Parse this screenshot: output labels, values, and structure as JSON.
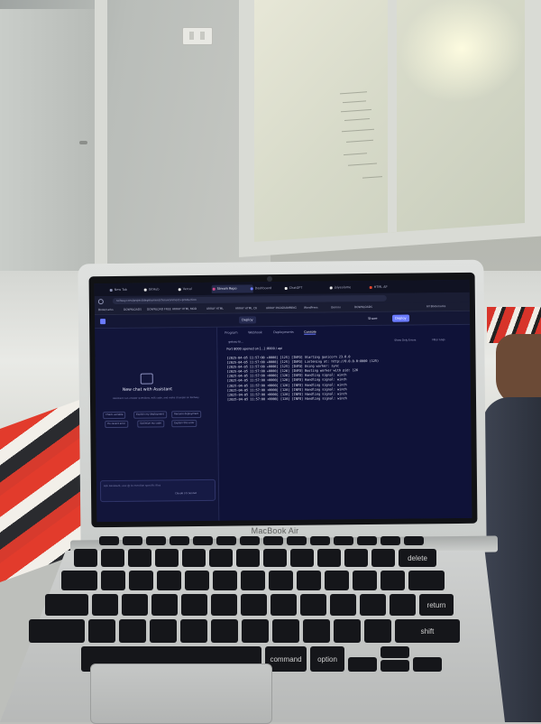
{
  "laptop": {
    "brand": "MacBook Air"
  },
  "browser": {
    "tabs": [
      {
        "label": "New Tab"
      },
      {
        "label": "GitHub"
      },
      {
        "label": "Vercel"
      },
      {
        "label": "Stream Repo"
      },
      {
        "label": "Dashboard"
      },
      {
        "label": "ChatGPT"
      },
      {
        "label": "jaiyeolame"
      },
      {
        "label": "HTML AP"
      }
    ],
    "url": "railway.com/project/deployments?environment=production",
    "bookmarks": [
      "Bookmarks",
      "DOWNLOADS",
      "DOWNLOAD FREE",
      "ARRAY HTML MOD",
      "ARRAY HTML",
      "ARRAY HTML CR",
      "ARRAY PROGRAMMING",
      "WordPress",
      "Gemini",
      "DOWNLOADS",
      "All Bookmarks"
    ],
    "bookmarks_right": "All Bookmarks"
  },
  "app": {
    "service": "Deploy",
    "share": "Share",
    "deploy": "Deploy",
    "tabs": [
      "Program",
      "Webhook",
      "Deployments",
      "Console"
    ],
    "assistant": {
      "title": "New chat with Assistant",
      "subtitle": "Assistant can answer questions, edit code, and make changes on Railway",
      "suggestions": [
        "Check variable",
        "Explain my deployment",
        "Rename deployment",
        "Fix recent error",
        "Optimize my code",
        "Explain this error"
      ],
      "input_placeholder": "Ask Assistant, use @ to mention specific files",
      "model": "Claude 3.5 Sonnet"
    },
    "console": {
      "service_name": "getssu-bi...",
      "port_line": "Port 8000 opened on [...] :8000 / api",
      "filters": [
        "Show Only Errors",
        "Filter Logs"
      ],
      "log_lines": [
        "[2025-04-05 11:57:00 +0000] [125] [INFO] Starting gunicorn 23.0.0",
        "[2025-04-05 11:57:00 +0000] [125] [INFO] Listening at: http://0.0.0.0:8000 (125)",
        "[2025-04-05 11:57:00 +0000] [125] [INFO] Using worker: sync",
        "[2025-04-05 11:57:00 +0000] [126] [INFO] Booting worker with pid: 126",
        "[2025-04-05 11:57:00 +0000] [126] [INFO] Handling signal: winch",
        "[2025-04-05 11:57:00 +0000] [126] [INFO] Handling signal: winch",
        "[2025-04-05 11:57:00 +0000] [126] [INFO] Handling signal: winch",
        "[2025-04-05 11:57:00 +0000] [126] [INFO] Handling signal: winch",
        "[2025-04-05 11:57:00 +0000] [126] [INFO] Handling signal: winch",
        "[2025-04-05 11:57:00 +0000] [126] [INFO] Handling signal: winch"
      ]
    }
  },
  "keyboard": {
    "keys": [
      "delete",
      "return",
      "shift",
      "command",
      "option"
    ]
  },
  "colors": {
    "screen_bg": "#171b3d",
    "console_bg": "#0f1238",
    "accent": "#6b7bff"
  }
}
